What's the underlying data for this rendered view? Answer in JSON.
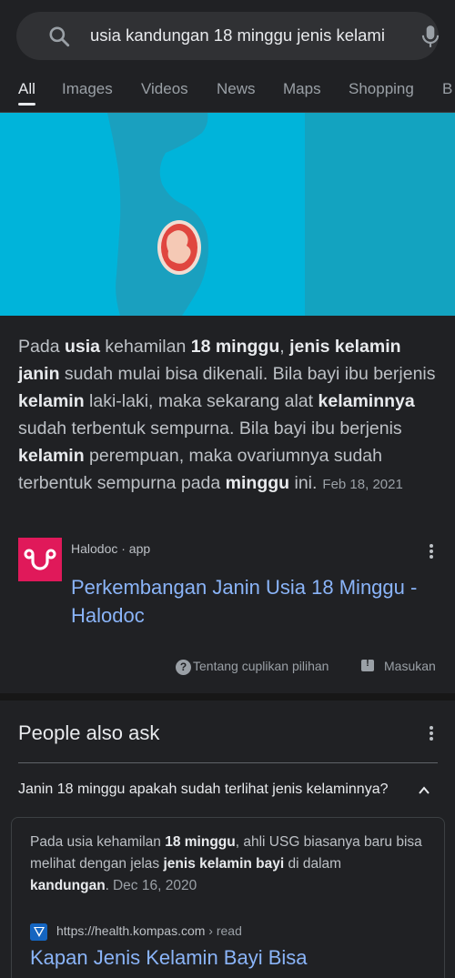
{
  "search": {
    "query": "usia kandungan 18 minggu jenis kelami"
  },
  "tabs": [
    "All",
    "Images",
    "Videos",
    "News",
    "Maps",
    "Shopping",
    "B"
  ],
  "snippet": {
    "text_parts": [
      {
        "t": "Pada ",
        "b": false
      },
      {
        "t": "usia",
        "b": true
      },
      {
        "t": " kehamilan ",
        "b": false
      },
      {
        "t": "18 minggu",
        "b": true
      },
      {
        "t": ", ",
        "b": false
      },
      {
        "t": "jenis kelamin janin",
        "b": true
      },
      {
        "t": " sudah mulai bisa dikenali. Bila bayi ibu berjenis ",
        "b": false
      },
      {
        "t": "kelamin",
        "b": true
      },
      {
        "t": " laki-laki, maka sekarang alat ",
        "b": false
      },
      {
        "t": "kelaminnya",
        "b": true
      },
      {
        "t": " sudah terbentuk sempurna. Bila bayi ibu berjenis ",
        "b": false
      },
      {
        "t": "kelamin",
        "b": true
      },
      {
        "t": " perempuan, maka ovariumnya sudah terbentuk sempurna pada ",
        "b": false
      },
      {
        "t": "minggu",
        "b": true
      },
      {
        "t": " ini.",
        "b": false
      }
    ],
    "date": "Feb 18, 2021"
  },
  "source": {
    "name": "Halodoc · app",
    "title": "Perkembangan Janin Usia 18 Minggu - Halodoc"
  },
  "about": {
    "about_label": "Tentang cuplikan pilihan",
    "feedback_label": "Masukan"
  },
  "paa": {
    "title": "People also ask",
    "question": "Janin 18 minggu apakah sudah terlihat jenis kelaminnya?",
    "answer_parts": [
      {
        "t": "Pada usia kehamilan ",
        "b": false
      },
      {
        "t": "18 minggu",
        "b": true
      },
      {
        "t": ", ahli USG biasanya baru bisa melihat dengan jelas ",
        "b": false
      },
      {
        "t": "jenis kelamin bayi",
        "b": true
      },
      {
        "t": " di dalam ",
        "b": false
      },
      {
        "t": "kandungan",
        "b": true
      },
      {
        "t": ".",
        "b": false
      }
    ],
    "answer_date": "Dec 16, 2020",
    "url": "https://health.kompas.com",
    "url_crumb": " › read",
    "result_title": "Kapan Jenis Kelamin Bayi Bisa"
  },
  "colors": {
    "background": "#202124",
    "link": "#8ab4f8",
    "halodoc_brand": "#e0195a",
    "hero_cyan": "#00b4da"
  },
  "icons": [
    "search-icon",
    "mic-icon",
    "halodoc-logo-icon",
    "more-vert-icon",
    "help-icon",
    "feedback-icon",
    "chevron-up-icon",
    "kompas-favicon"
  ]
}
